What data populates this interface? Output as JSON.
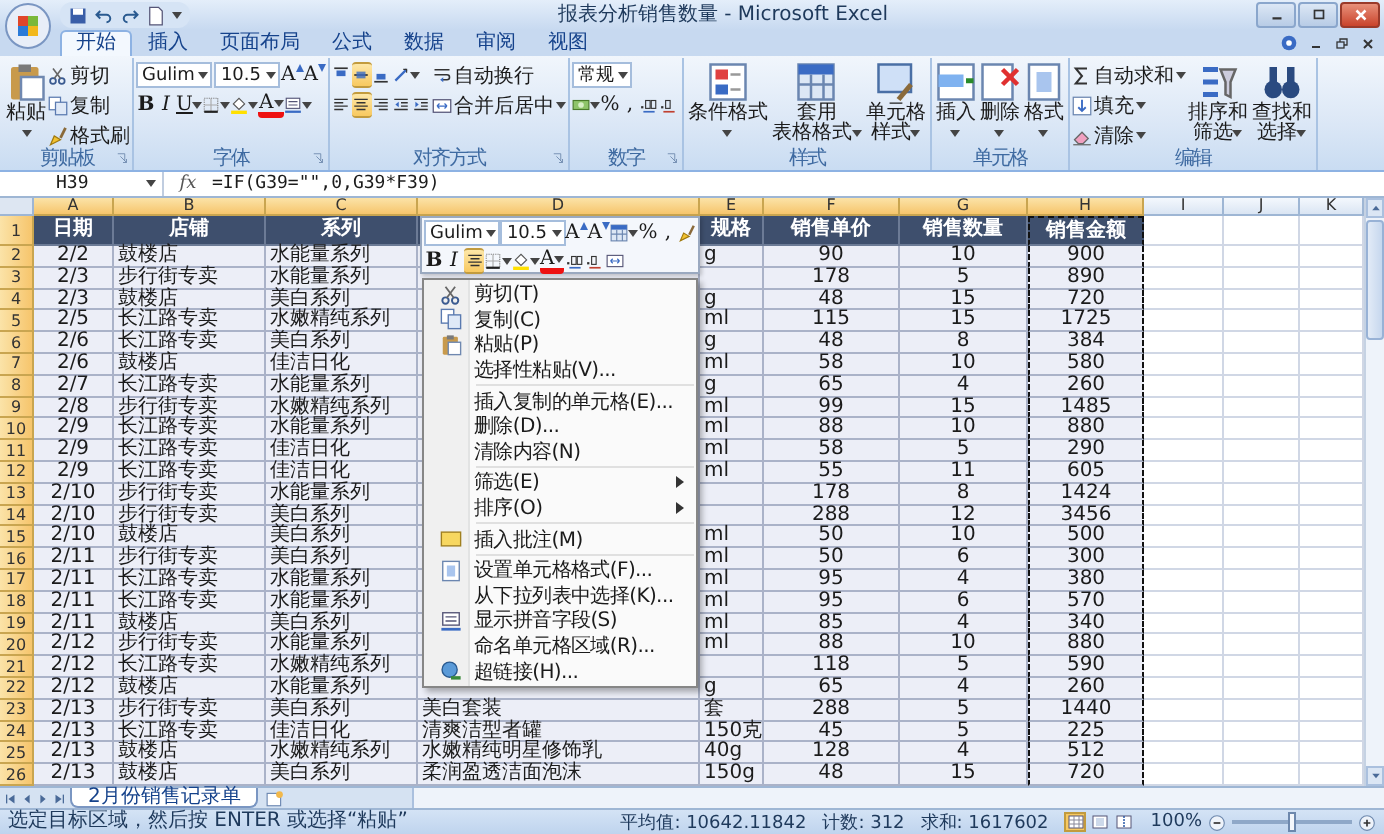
{
  "window": {
    "title": "报表分析销售数量 - Microsoft Excel"
  },
  "ribbon_tabs": [
    {
      "label": "开始",
      "selected": true
    },
    {
      "label": "插入",
      "selected": false
    },
    {
      "label": "页面布局",
      "selected": false
    },
    {
      "label": "公式",
      "selected": false
    },
    {
      "label": "数据",
      "selected": false
    },
    {
      "label": "审阅",
      "selected": false
    },
    {
      "label": "视图",
      "selected": false
    }
  ],
  "ribbon_groups": [
    {
      "label": "剪贴板",
      "launcher": true,
      "columns": [
        {
          "kind": "large",
          "lines": [
            "粘贴"
          ],
          "dropdown": true
        },
        {
          "kind": "stack",
          "rows": [
            {
              "controls": [
                {
                  "kind": "small",
                  "text": "剪切"
                }
              ]
            },
            {
              "controls": [
                {
                  "kind": "small",
                  "text": "复制"
                }
              ]
            },
            {
              "controls": [
                {
                  "kind": "small",
                  "text": "格式刷"
                }
              ]
            }
          ]
        }
      ]
    },
    {
      "label": "字体",
      "launcher": true,
      "columns": [
        {
          "kind": "stack",
          "rows": [
            {
              "controls": [
                {
                  "kind": "field",
                  "value": "Gulim",
                  "dropdown": true
                },
                {
                  "kind": "field",
                  "value": "10.5",
                  "dropdown": true
                },
                {
                  "kind": "grow",
                  "text": "A"
                },
                {
                  "kind": "shrink",
                  "text": "A"
                }
              ]
            },
            {
              "controls": [
                {
                  "kind": "bold",
                  "text": "B"
                },
                {
                  "kind": "italic",
                  "text": "I"
                },
                {
                  "kind": "underline",
                  "text": "U",
                  "dropdown": true
                },
                {
                  "kind": "icon",
                  "dropdown": true
                },
                {
                  "kind": "icon",
                  "dropdown": true
                },
                {
                  "kind": "font-color",
                  "text": "A",
                  "dropdown": true
                },
                {
                  "kind": "icon",
                  "dropdown": true
                }
              ]
            }
          ]
        }
      ]
    },
    {
      "label": "对齐方式",
      "launcher": true,
      "columns": [
        {
          "kind": "stack",
          "rows": [
            {
              "controls": [
                {
                  "kind": "icon",
                  "selected": false
                },
                {
                  "kind": "icon",
                  "selected": true
                },
                {
                  "kind": "icon",
                  "selected": false
                },
                {
                  "kind": "icon",
                  "dropdown": true
                }
              ]
            },
            {
              "controls": [
                {
                  "kind": "icon",
                  "selected": false
                },
                {
                  "kind": "icon",
                  "selected": true
                },
                {
                  "kind": "icon",
                  "selected": false
                },
                {
                  "kind": "icon"
                },
                {
                  "kind": "icon"
                }
              ]
            }
          ]
        },
        {
          "kind": "stack",
          "rows": [
            {
              "controls": [
                {
                  "kind": "small",
                  "text": "自动换行"
                }
              ]
            },
            {
              "controls": [
                {
                  "kind": "small",
                  "text": "合并后居中",
                  "dropdown": true
                }
              ]
            }
          ]
        }
      ]
    },
    {
      "label": "数字",
      "launcher": true,
      "columns": [
        {
          "kind": "stack",
          "rows": [
            {
              "controls": [
                {
                  "kind": "field",
                  "value": "常规",
                  "dropdown": true
                }
              ]
            },
            {
              "controls": [
                {
                  "kind": "icon",
                  "dropdown": true
                },
                {
                  "kind": "tool",
                  "text": "%"
                },
                {
                  "kind": "tool",
                  "text": ","
                },
                {
                  "kind": "icon"
                },
                {
                  "kind": "icon"
                }
              ]
            }
          ]
        }
      ]
    },
    {
      "label": "样式",
      "columns": [
        {
          "kind": "large",
          "lines": [
            "条件格式"
          ],
          "dropdown": true
        },
        {
          "kind": "large",
          "lines": [
            "套用",
            "表格格式"
          ],
          "dropdown": true
        },
        {
          "kind": "large",
          "lines": [
            "单元格",
            "样式"
          ],
          "dropdown": true
        }
      ]
    },
    {
      "label": "单元格",
      "columns": [
        {
          "kind": "large",
          "lines": [
            "插入"
          ],
          "dropdown": true
        },
        {
          "kind": "large",
          "lines": [
            "删除"
          ],
          "dropdown": true
        },
        {
          "kind": "large",
          "lines": [
            "格式"
          ],
          "dropdown": true
        }
      ]
    },
    {
      "label": "编辑",
      "columns": [
        {
          "kind": "stack",
          "rows": [
            {
              "controls": [
                {
                  "kind": "small",
                  "text": "自动求和",
                  "dropdown": true
                }
              ]
            },
            {
              "controls": [
                {
                  "kind": "small",
                  "text": "填充",
                  "dropdown": true
                }
              ]
            },
            {
              "controls": [
                {
                  "kind": "small",
                  "text": "清除",
                  "dropdown": true
                }
              ]
            }
          ]
        },
        {
          "kind": "large",
          "lines": [
            "排序和",
            "筛选"
          ],
          "dropdown": true
        },
        {
          "kind": "large",
          "lines": [
            "查找和",
            "选择"
          ],
          "dropdown": true
        }
      ]
    }
  ],
  "formula_bar": {
    "name_box": "H39",
    "function_label": "fx",
    "formula": "=IF(G39=\"\",0,G39*F39)"
  },
  "sheet": {
    "columns": [
      {
        "label": "A",
        "selected": true,
        "copied": false
      },
      {
        "label": "B",
        "selected": true,
        "copied": false
      },
      {
        "label": "C",
        "selected": true,
        "copied": false
      },
      {
        "label": "D",
        "selected": true,
        "copied": false
      },
      {
        "label": "E",
        "selected": true,
        "copied": false
      },
      {
        "label": "F",
        "selected": true,
        "copied": false
      },
      {
        "label": "G",
        "selected": true,
        "copied": false
      },
      {
        "label": "H",
        "selected": true,
        "copied": true
      },
      {
        "label": "I",
        "selected": false,
        "copied": false
      },
      {
        "label": "J",
        "selected": false,
        "copied": false
      },
      {
        "label": "K",
        "selected": false,
        "copied": false
      }
    ],
    "rows": [
      {
        "header": "1",
        "selected": true,
        "kind": "header",
        "cells": [
          "日期",
          "店铺",
          "系列",
          null,
          "规格",
          "销售单价",
          "销售数量",
          "销售金额",
          null,
          null,
          null
        ]
      },
      {
        "header": "2",
        "selected": true,
        "kind": "data",
        "cells": [
          "2/2",
          "鼓楼店",
          "水能量系列",
          null,
          "g",
          "90",
          "10",
          "900",
          null,
          null,
          null
        ]
      },
      {
        "header": "3",
        "selected": true,
        "kind": "data",
        "cells": [
          "2/3",
          "步行街专卖",
          "水能量系列",
          null,
          null,
          "178",
          "5",
          "890",
          null,
          null,
          null
        ]
      },
      {
        "header": "4",
        "selected": true,
        "kind": "data",
        "cells": [
          "2/3",
          "鼓楼店",
          "美白系列",
          null,
          "g",
          "48",
          "15",
          "720",
          null,
          null,
          null
        ]
      },
      {
        "header": "5",
        "selected": true,
        "kind": "data",
        "cells": [
          "2/5",
          "长江路专卖",
          "水嫩精纯系列",
          null,
          "ml",
          "115",
          "15",
          "1725",
          null,
          null,
          null
        ]
      },
      {
        "header": "6",
        "selected": true,
        "kind": "data",
        "cells": [
          "2/6",
          "长江路专卖",
          "美白系列",
          null,
          "g",
          "48",
          "8",
          "384",
          null,
          null,
          null
        ]
      },
      {
        "header": "7",
        "selected": true,
        "kind": "data",
        "cells": [
          "2/6",
          "鼓楼店",
          "佳洁日化",
          null,
          "ml",
          "58",
          "10",
          "580",
          null,
          null,
          null
        ]
      },
      {
        "header": "8",
        "selected": true,
        "kind": "data",
        "cells": [
          "2/7",
          "长江路专卖",
          "水能量系列",
          null,
          "g",
          "65",
          "4",
          "260",
          null,
          null,
          null
        ]
      },
      {
        "header": "9",
        "selected": true,
        "kind": "data",
        "cells": [
          "2/8",
          "步行街专卖",
          "水嫩精纯系列",
          null,
          "ml",
          "99",
          "15",
          "1485",
          null,
          null,
          null
        ]
      },
      {
        "header": "10",
        "selected": true,
        "kind": "data",
        "cells": [
          "2/9",
          "长江路专卖",
          "水能量系列",
          null,
          "ml",
          "88",
          "10",
          "880",
          null,
          null,
          null
        ]
      },
      {
        "header": "11",
        "selected": true,
        "kind": "data",
        "cells": [
          "2/9",
          "长江路专卖",
          "佳洁日化",
          null,
          "ml",
          "58",
          "5",
          "290",
          null,
          null,
          null
        ]
      },
      {
        "header": "12",
        "selected": true,
        "kind": "data",
        "cells": [
          "2/9",
          "长江路专卖",
          "佳洁日化",
          null,
          "ml",
          "55",
          "11",
          "605",
          null,
          null,
          null
        ]
      },
      {
        "header": "13",
        "selected": true,
        "kind": "data",
        "cells": [
          "2/10",
          "步行街专卖",
          "水能量系列",
          null,
          null,
          "178",
          "8",
          "1424",
          null,
          null,
          null
        ]
      },
      {
        "header": "14",
        "selected": true,
        "kind": "data",
        "cells": [
          "2/10",
          "步行街专卖",
          "美白系列",
          null,
          null,
          "288",
          "12",
          "3456",
          null,
          null,
          null
        ]
      },
      {
        "header": "15",
        "selected": true,
        "kind": "data",
        "cells": [
          "2/10",
          "鼓楼店",
          "美白系列",
          null,
          "ml",
          "50",
          "10",
          "500",
          null,
          null,
          null
        ]
      },
      {
        "header": "16",
        "selected": true,
        "kind": "data",
        "cells": [
          "2/11",
          "步行街专卖",
          "美白系列",
          null,
          "ml",
          "50",
          "6",
          "300",
          null,
          null,
          null
        ]
      },
      {
        "header": "17",
        "selected": true,
        "kind": "data",
        "cells": [
          "2/11",
          "长江路专卖",
          "水能量系列",
          null,
          "ml",
          "95",
          "4",
          "380",
          null,
          null,
          null
        ]
      },
      {
        "header": "18",
        "selected": true,
        "kind": "data",
        "cells": [
          "2/11",
          "长江路专卖",
          "水能量系列",
          null,
          "ml",
          "95",
          "6",
          "570",
          null,
          null,
          null
        ]
      },
      {
        "header": "19",
        "selected": true,
        "kind": "data",
        "cells": [
          "2/11",
          "鼓楼店",
          "美白系列",
          null,
          "ml",
          "85",
          "4",
          "340",
          null,
          null,
          null
        ]
      },
      {
        "header": "20",
        "selected": true,
        "kind": "data",
        "cells": [
          "2/12",
          "步行街专卖",
          "水能量系列",
          null,
          "ml",
          "88",
          "10",
          "880",
          null,
          null,
          null
        ]
      },
      {
        "header": "21",
        "selected": true,
        "kind": "data",
        "cells": [
          "2/12",
          "长江路专卖",
          "水嫩精纯系列",
          null,
          null,
          "118",
          "5",
          "590",
          null,
          null,
          null
        ]
      },
      {
        "header": "22",
        "selected": true,
        "kind": "data",
        "cells": [
          "2/12",
          "鼓楼店",
          "水能量系列",
          null,
          "g",
          "65",
          "4",
          "260",
          null,
          null,
          null
        ]
      },
      {
        "header": "23",
        "selected": true,
        "kind": "data",
        "cells": [
          "2/13",
          "步行街专卖",
          "美白系列",
          "美白套装",
          "套",
          "288",
          "5",
          "1440",
          null,
          null,
          null
        ]
      },
      {
        "header": "24",
        "selected": true,
        "kind": "data",
        "cells": [
          "2/13",
          "长江路专卖",
          "佳洁日化",
          "清爽洁型者罐",
          "150克",
          "45",
          "5",
          "225",
          null,
          null,
          null
        ]
      },
      {
        "header": "25",
        "selected": true,
        "kind": "data",
        "cells": [
          "2/13",
          "鼓楼店",
          "水嫩精纯系列",
          "水嫩精纯明星修饰乳",
          "40g",
          "128",
          "4",
          "512",
          null,
          null,
          null
        ]
      },
      {
        "header": "26",
        "selected": true,
        "kind": "data",
        "cells": [
          "2/13",
          "鼓楼店",
          "美白系列",
          "柔润盈透洁面泡沫",
          "150g",
          "48",
          "15",
          "720",
          null,
          null,
          null
        ]
      }
    ]
  },
  "mini_toolbar": {
    "rows": [
      {
        "controls": [
          {
            "kind": "field",
            "value": "Gulim",
            "dropdown": true
          },
          {
            "kind": "field",
            "value": "10.5",
            "dropdown": true
          },
          {
            "kind": "grow",
            "text": "A"
          },
          {
            "kind": "shrink",
            "text": "A"
          },
          {
            "kind": "icon",
            "dropdown": true
          },
          {
            "kind": "tool",
            "text": "%"
          },
          {
            "kind": "tool",
            "text": ","
          },
          {
            "kind": "icon"
          }
        ]
      },
      {
        "controls": [
          {
            "kind": "bold",
            "text": "B"
          },
          {
            "kind": "italic",
            "text": "I"
          },
          {
            "kind": "icon",
            "selected": true
          },
          {
            "kind": "icon",
            "dropdown": true
          },
          {
            "kind": "icon",
            "dropdown": true
          },
          {
            "kind": "font-color",
            "text": "A",
            "dropdown": true
          },
          {
            "kind": "icon"
          },
          {
            "kind": "icon"
          },
          {
            "kind": "icon"
          }
        ]
      }
    ]
  },
  "context_menu": {
    "items": [
      {
        "kind": "icon-item",
        "label": "剪切(T)"
      },
      {
        "kind": "icon-item",
        "label": "复制(C)"
      },
      {
        "kind": "icon-item",
        "label": "粘贴(P)"
      },
      {
        "kind": "item",
        "label": "选择性粘贴(V)..."
      },
      {
        "kind": "separator"
      },
      {
        "kind": "item",
        "label": "插入复制的单元格(E)..."
      },
      {
        "kind": "item",
        "label": "删除(D)..."
      },
      {
        "kind": "item",
        "label": "清除内容(N)"
      },
      {
        "kind": "separator"
      },
      {
        "kind": "submenu",
        "label": "筛选(E)"
      },
      {
        "kind": "submenu",
        "label": "排序(O)"
      },
      {
        "kind": "separator"
      },
      {
        "kind": "icon-item",
        "label": "插入批注(M)"
      },
      {
        "kind": "separator"
      },
      {
        "kind": "icon-item",
        "label": "设置单元格格式(F)..."
      },
      {
        "kind": "item",
        "label": "从下拉列表中选择(K)..."
      },
      {
        "kind": "icon-item",
        "label": "显示拼音字段(S)"
      },
      {
        "kind": "item",
        "label": "命名单元格区域(R)..."
      },
      {
        "kind": "icon-item",
        "label": "超链接(H)..."
      }
    ]
  },
  "sheet_tabs": [
    {
      "label": "2月份销售记录单",
      "selected": true
    }
  ],
  "status_bar": {
    "message": "选定目标区域，然后按 ENTER 或选择“粘贴”",
    "stats": [
      "平均值: 10642.11842",
      "计数: 312",
      "求和: 1617602"
    ],
    "views": [
      {
        "selected": true
      },
      {
        "selected": false
      },
      {
        "selected": false
      }
    ],
    "zoom": "100%",
    "level": 0.5
  }
}
